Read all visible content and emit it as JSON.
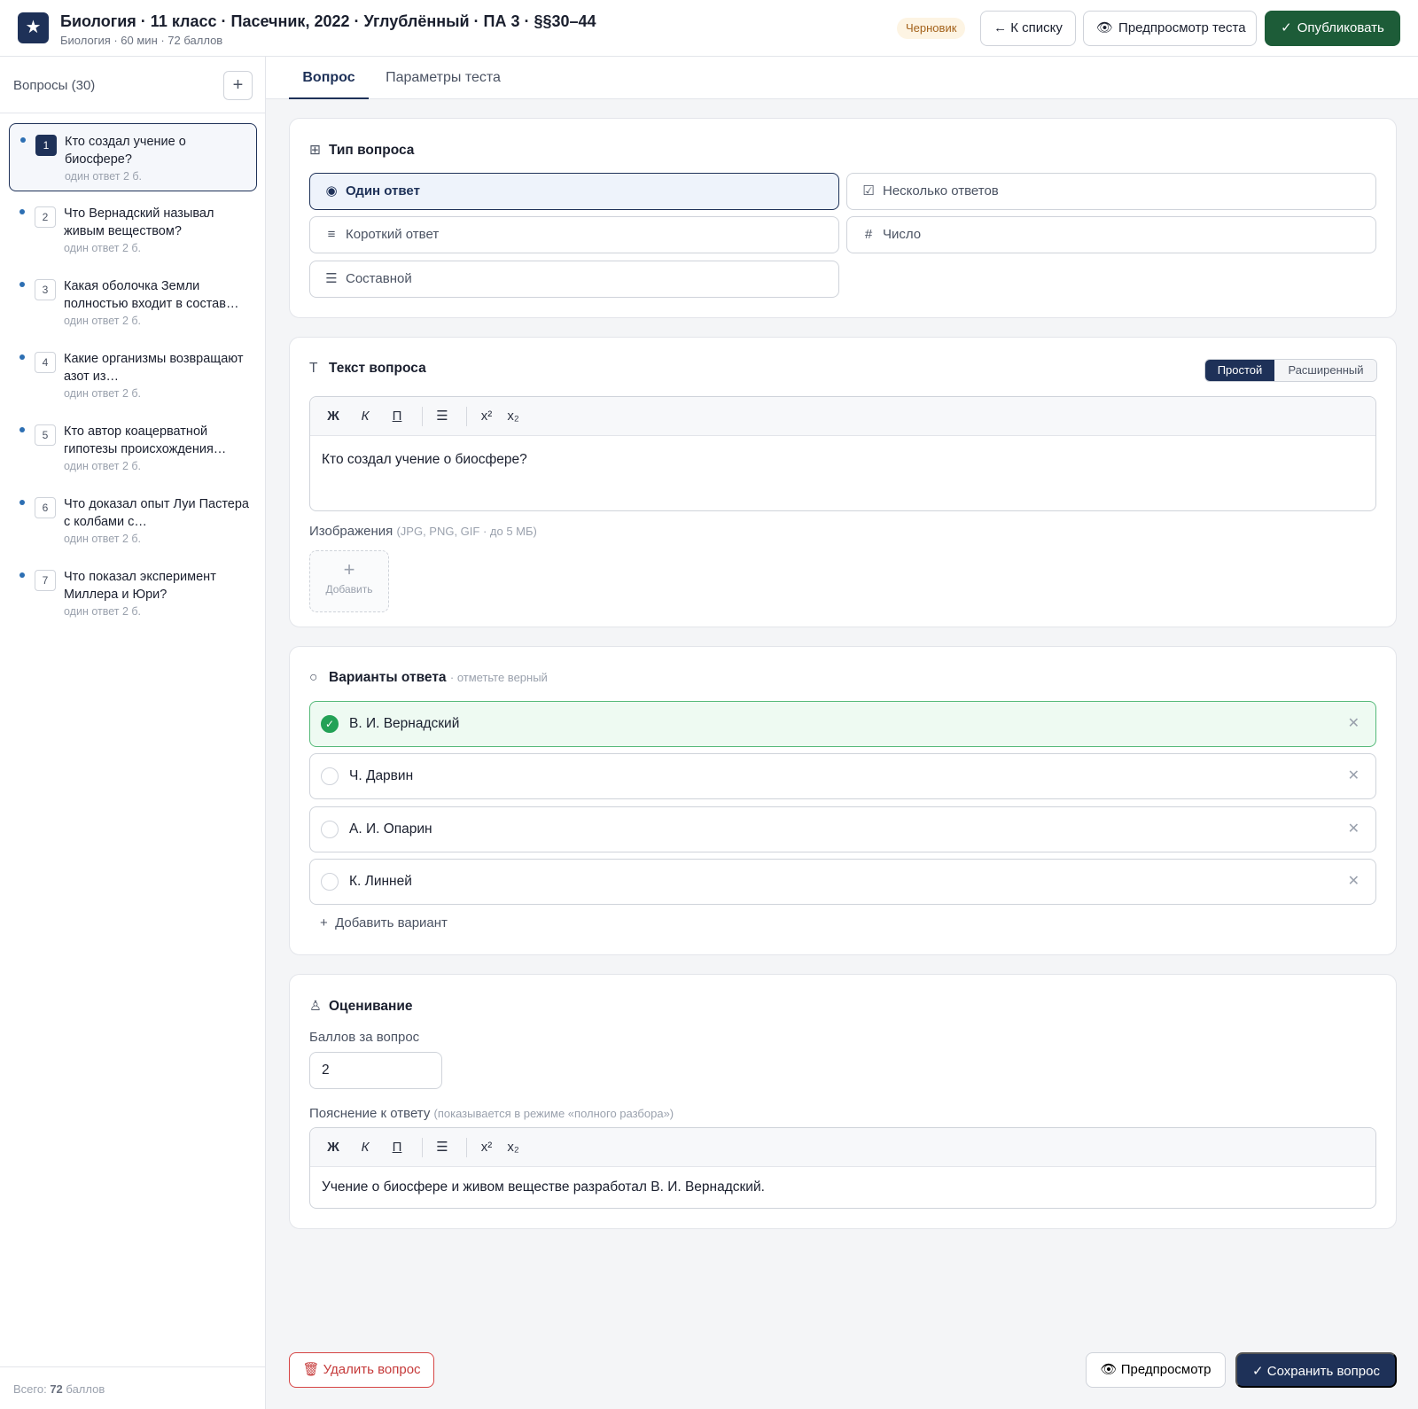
{
  "header": {
    "logo_glyph": "★",
    "title": "Биология · 11 класс · Пасечник, 2022 · Углублённый · ПА 3 · §§30–44",
    "subtitle": "Биология · 60 мин · 72 баллов",
    "status_badge": "Черновик",
    "back_label": "← К списку",
    "preview_test_label": "Предпросмотр теста",
    "publish_label": "Опубликовать"
  },
  "sidebar": {
    "title": "Вопросы (30)",
    "questions": [
      {
        "num": "1",
        "text": "Кто создал учение о биосфере?",
        "meta": "один ответ  2 б."
      },
      {
        "num": "2",
        "text": "Что Вернадский называл живым веществом?",
        "meta": "один ответ  2 б."
      },
      {
        "num": "3",
        "text": "Какая оболочка Земли полностью входит в состав…",
        "meta": "один ответ  2 б."
      },
      {
        "num": "4",
        "text": "Какие организмы возвращают азот из…",
        "meta": "один ответ  2 б."
      },
      {
        "num": "5",
        "text": "Кто автор коацерватной гипотезы происхождения…",
        "meta": "один ответ  2 б."
      },
      {
        "num": "6",
        "text": "Что доказал опыт Луи Пастера с колбами с…",
        "meta": "один ответ  2 б."
      },
      {
        "num": "7",
        "text": "Что показал эксперимент Миллера и Юри?",
        "meta": "один ответ  2 б."
      }
    ],
    "footer_prefix": "Всего:",
    "footer_total": "72",
    "footer_suffix": "баллов"
  },
  "tabs": [
    "Вопрос",
    "Параметры теста"
  ],
  "type_section": {
    "title": "Тип вопроса",
    "options": [
      "Один ответ",
      "Несколько ответов",
      "Короткий ответ",
      "Число",
      "Составной"
    ],
    "selected": "Один ответ"
  },
  "text_section": {
    "title": "Текст вопроса",
    "mode_simple": "Простой",
    "mode_advanced": "Расширенный",
    "toolbar": {
      "bold": "Ж",
      "italic": "К",
      "underline": "П",
      "list": "☰",
      "sup": "x²",
      "sub": "x₂"
    },
    "question_text": "Кто создал учение о биосфере?",
    "images_label": "Изображения",
    "images_hint": "(JPG, PNG, GIF · до 5 МБ)",
    "add_image_label": "Добавить"
  },
  "answers_section": {
    "title": "Варианты ответа",
    "hint": "· отметьте верный",
    "answers": [
      {
        "text": "В. И. Вернадский",
        "correct": true
      },
      {
        "text": "Ч. Дарвин",
        "correct": false
      },
      {
        "text": "А. И. Опарин",
        "correct": false
      },
      {
        "text": "К. Линней",
        "correct": false
      }
    ],
    "add_variant_label": "Добавить вариант"
  },
  "grading_section": {
    "title": "Оценивание",
    "points_label": "Баллов за вопрос",
    "points_value": "2",
    "explanation_label": "Пояснение к ответу",
    "explanation_hint": "(показывается в режиме «полного разбора»)",
    "explanation_text": "Учение о биосфере и живом веществе разработал В. И. Вернадский."
  },
  "footer": {
    "delete_label": "Удалить вопрос",
    "preview_label": "Предпросмотр",
    "save_label": "Сохранить вопрос"
  },
  "colors": {
    "primary": "#1e3158",
    "publish": "#1d5c38",
    "correct": "#23a156",
    "danger": "#c53a3a"
  }
}
